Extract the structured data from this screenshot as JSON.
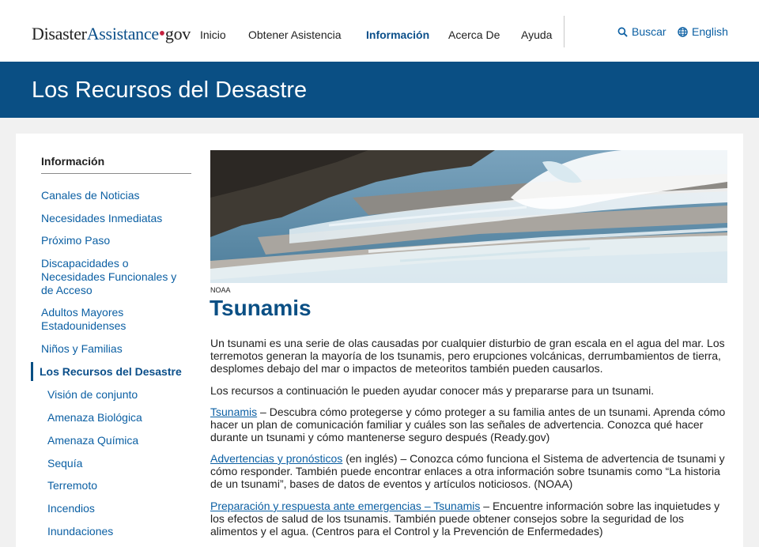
{
  "header": {
    "logo": {
      "part1": "Disaster",
      "part2": "Assistance",
      "part3": "gov"
    },
    "nav": [
      {
        "label": "Inicio",
        "active": false
      },
      {
        "label": "Obtener Asistencia",
        "active": false
      },
      {
        "label": "Información",
        "active": true
      },
      {
        "label": "Acerca De",
        "active": false
      },
      {
        "label": "Ayuda",
        "active": false
      }
    ],
    "search_label": "Buscar",
    "language_label": "English"
  },
  "banner": {
    "title": "Los Recursos del Desastre"
  },
  "sidebar": {
    "heading": "Información",
    "items": [
      {
        "label": "Canales de Noticias"
      },
      {
        "label": "Necesidades Inmediatas"
      },
      {
        "label": "Próximo Paso"
      },
      {
        "label": "Discapacidades o Necesidades Funcionales y de Acceso"
      },
      {
        "label": "Adultos Mayores Estadounidenses"
      },
      {
        "label": "Niños y Familias"
      },
      {
        "label": "Los Recursos del Desastre"
      }
    ],
    "subitems": [
      {
        "label": "Visión de conjunto"
      },
      {
        "label": "Amenaza Biológica"
      },
      {
        "label": "Amenaza Química"
      },
      {
        "label": "Sequía"
      },
      {
        "label": "Terremoto"
      },
      {
        "label": "Incendios"
      },
      {
        "label": "Inundaciones"
      }
    ]
  },
  "content": {
    "image_credit": "NOAA",
    "title": "Tsunamis",
    "intro": "Un tsunami es una serie de olas causadas por cualquier disturbio de gran escala en el agua del mar. Los terremotos generan la mayoría de los tsunamis, pero erupciones volcánicas, derrumbamientos de tierra, desplomes debajo del mar o impactos de meteoritos también pueden causarlos.",
    "lead": "Los recursos a continuación le pueden ayudar conocer más y prepararse para un tsunami.",
    "resources": [
      {
        "link": "Tsunamis",
        "text": " – Descubra cómo protegerse y cómo proteger a su familia antes de un tsunami. Aprenda cómo hacer un plan de comunicación familiar y cuáles son las señales de advertencia. Conozca qué hacer durante un tsunami y cómo mantenerse seguro después (Ready.gov)"
      },
      {
        "link": "Advertencias y pronósticos",
        "text": " (en inglés) – Conozca cómo funciona el Sistema de advertencia de tsunami y cómo responder. También puede encontrar enlaces a otra información sobre tsunamis como “La historia de un tsunami”, bases de datos de eventos y artículos noticiosos. (NOAA)"
      },
      {
        "link": "Preparación y respuesta ante emergencias – Tsunamis",
        "text": " – Encuentre información sobre las inquietudes y los efectos de salud de los tsunamis. También puede obtener consejos sobre la seguridad de los alimentos y el agua. (Centros para el Control y la Prevención de Enfermedades)"
      }
    ]
  },
  "colors": {
    "brand_blue": "#0a4f84",
    "link_blue": "#0b5fa3",
    "logo_dot_red": "#c5203e"
  }
}
